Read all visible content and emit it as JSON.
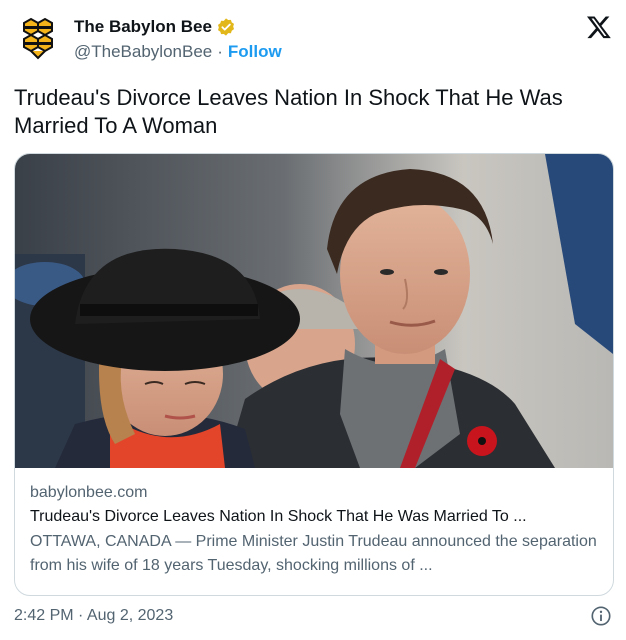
{
  "author": {
    "display_name": "The Babylon Bee",
    "handle": "@TheBabylonBee",
    "separator": "·",
    "follow_label": "Follow",
    "verified_badge_color": "#e2b719"
  },
  "icons": {
    "avatar": "babylon-bee-logo-icon",
    "verified": "verified-badge-icon",
    "platform": "x-logo-icon",
    "info": "info-icon"
  },
  "tweet": {
    "text": "Trudeau's Divorce Leaves Nation In Shock That He Was Married To A Woman"
  },
  "card": {
    "domain": "babylonbee.com",
    "title": "Trudeau's Divorce Leaves Nation In Shock That He Was Married To ...",
    "description": "OTTAWA, CANADA — Prime Minister Justin Trudeau announced the separation from his wife of 18 years Tuesday, shocking millions of ..."
  },
  "footer": {
    "timestamp": "2:42 PM · Aug 2, 2023"
  },
  "colors": {
    "accent": "#1d9bf0",
    "text_primary": "#0f1419",
    "text_secondary": "#536471",
    "border": "#cfd9de"
  }
}
